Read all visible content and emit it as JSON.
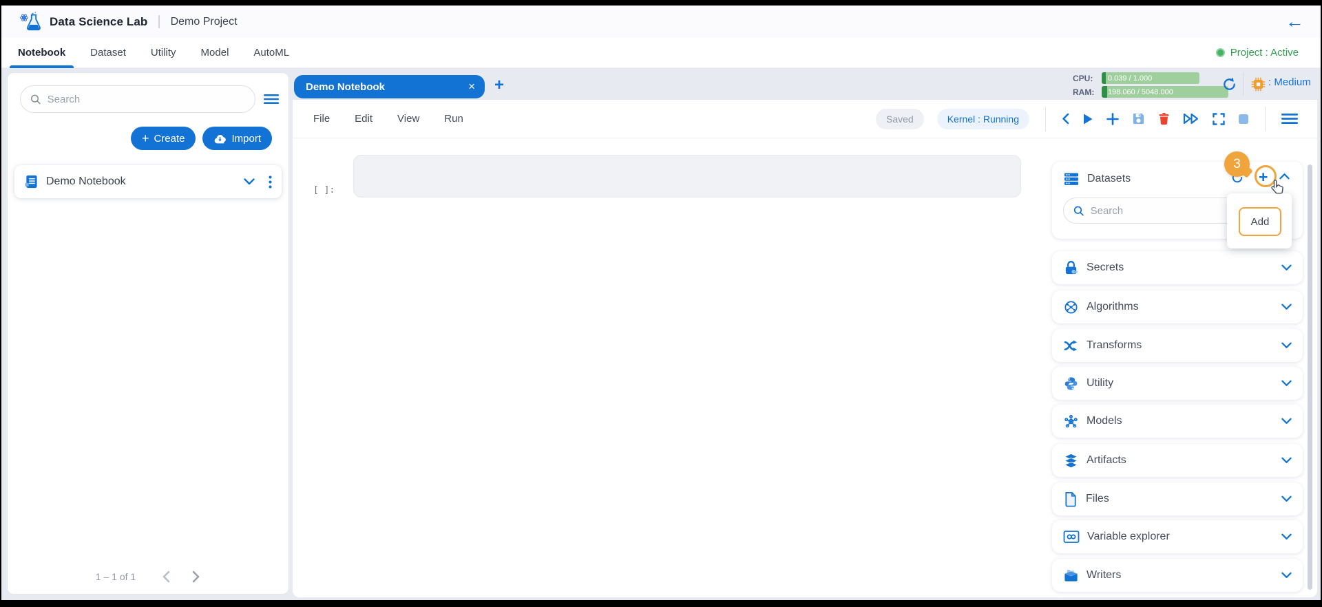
{
  "header": {
    "app_title": "Data Science Lab",
    "project_name": "Demo Project"
  },
  "nav": {
    "tabs": [
      {
        "label": "Notebook"
      },
      {
        "label": "Dataset"
      },
      {
        "label": "Utility"
      },
      {
        "label": "Model"
      },
      {
        "label": "AutoML"
      }
    ],
    "project_status": "Project : Active"
  },
  "left_panel": {
    "search_placeholder": "Search",
    "create_label": "Create",
    "import_label": "Import",
    "notebook_item": "Demo Notebook",
    "pagination": "1 – 1 of 1"
  },
  "workspace": {
    "tab_title": "Demo Notebook",
    "resources": {
      "cpu_label": "CPU:",
      "cpu_value": "0.039 / 1.000",
      "ram_label": "RAM:",
      "ram_value": "198.060 / 5048.000",
      "instance_label": ": Medium"
    },
    "menus": [
      "File",
      "Edit",
      "View",
      "Run"
    ],
    "save_status": "Saved",
    "kernel_status": "Kernel : Running",
    "cell_prompt": "[  ]:"
  },
  "right_panel": {
    "datasets": {
      "label": "Datasets",
      "search_placeholder": "Search"
    },
    "sections": [
      {
        "label": "Secrets"
      },
      {
        "label": "Algorithms"
      },
      {
        "label": "Transforms"
      },
      {
        "label": "Utility"
      },
      {
        "label": "Models"
      },
      {
        "label": "Artifacts"
      },
      {
        "label": "Files"
      },
      {
        "label": "Variable explorer"
      },
      {
        "label": "Writers"
      }
    ],
    "annotation": {
      "step_badge": "3",
      "tooltip_label": "Add"
    }
  },
  "glyphs": {
    "back_arrow": "←",
    "close": "×",
    "add_tab": "+",
    "plus": "+",
    "ds_plus": "+"
  },
  "colors": {
    "primary": "#1273d4",
    "accent_orange": "#f0a53c",
    "active_green": "#2f9e4f",
    "danger": "#e8432e",
    "resource_bar_bg": "#9ecf9d",
    "resource_bar_fill": "#2f8f46"
  }
}
